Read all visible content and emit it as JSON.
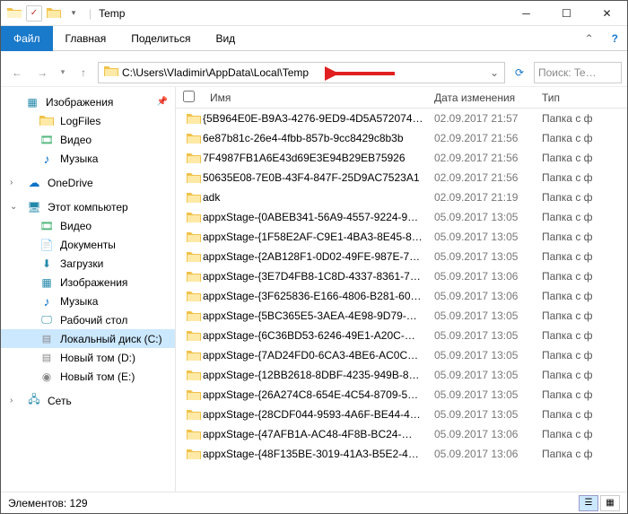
{
  "title": "Temp",
  "tabs": {
    "file": "Файл",
    "home": "Главная",
    "share": "Поделиться",
    "view": "Вид"
  },
  "address": "C:\\Users\\Vladimir\\AppData\\Local\\Temp",
  "search_placeholder": "Поиск: Te…",
  "sidebar": {
    "quick": {
      "label": "Изображения",
      "pin": "📌"
    },
    "quick_items": [
      {
        "icon": "folder",
        "label": "LogFiles"
      },
      {
        "icon": "video",
        "label": "Видео"
      },
      {
        "icon": "music",
        "label": "Музыка"
      }
    ],
    "onedrive": "OneDrive",
    "thispc": "Этот компьютер",
    "pc_items": [
      {
        "icon": "video",
        "label": "Видео"
      },
      {
        "icon": "doc",
        "label": "Документы"
      },
      {
        "icon": "dl",
        "label": "Загрузки"
      },
      {
        "icon": "pic",
        "label": "Изображения"
      },
      {
        "icon": "music",
        "label": "Музыка"
      },
      {
        "icon": "desk",
        "label": "Рабочий стол"
      },
      {
        "icon": "drive",
        "label": "Локальный диск (C:)",
        "selected": true
      },
      {
        "icon": "drive",
        "label": "Новый том (D:)"
      },
      {
        "icon": "cd",
        "label": "Новый том (E:)"
      }
    ],
    "network": "Сеть"
  },
  "columns": {
    "name": "Имя",
    "date": "Дата изменения",
    "type": "Тип"
  },
  "files": [
    {
      "name": "{5B964E0E-B9A3-4276-9ED9-4D5A572074…",
      "date": "02.09.2017 21:57",
      "type": "Папка с ф"
    },
    {
      "name": "6e87b81c-26e4-4fbb-857b-9cc8429c8b3b",
      "date": "02.09.2017 21:56",
      "type": "Папка с ф"
    },
    {
      "name": "7F4987FB1A6E43d69E3E94B29EB75926",
      "date": "02.09.2017 21:56",
      "type": "Папка с ф"
    },
    {
      "name": "50635E08-7E0B-43F4-847F-25D9AC7523A1",
      "date": "02.09.2017 21:56",
      "type": "Папка с ф"
    },
    {
      "name": "adk",
      "date": "02.09.2017 21:19",
      "type": "Папка с ф"
    },
    {
      "name": "appxStage-{0ABEB341-56A9-4557-9224-9…",
      "date": "05.09.2017 13:05",
      "type": "Папка с ф"
    },
    {
      "name": "appxStage-{1F58E2AF-C9E1-4BA3-8E45-8…",
      "date": "05.09.2017 13:05",
      "type": "Папка с ф"
    },
    {
      "name": "appxStage-{2AB128F1-0D02-49FE-987E-7…",
      "date": "05.09.2017 13:05",
      "type": "Папка с ф"
    },
    {
      "name": "appxStage-{3E7D4FB8-1C8D-4337-8361-7…",
      "date": "05.09.2017 13:06",
      "type": "Папка с ф"
    },
    {
      "name": "appxStage-{3F625836-E166-4806-B281-60…",
      "date": "05.09.2017 13:06",
      "type": "Папка с ф"
    },
    {
      "name": "appxStage-{5BC365E5-3AEA-4E98-9D79-…",
      "date": "05.09.2017 13:05",
      "type": "Папка с ф"
    },
    {
      "name": "appxStage-{6C36BD53-6246-49E1-A20C-…",
      "date": "05.09.2017 13:05",
      "type": "Папка с ф"
    },
    {
      "name": "appxStage-{7AD24FD0-6CA3-4BE6-AC0C…",
      "date": "05.09.2017 13:05",
      "type": "Папка с ф"
    },
    {
      "name": "appxStage-{12BB2618-8DBF-4235-949B-8…",
      "date": "05.09.2017 13:05",
      "type": "Папка с ф"
    },
    {
      "name": "appxStage-{26A274C8-654E-4C54-8709-5…",
      "date": "05.09.2017 13:05",
      "type": "Папка с ф"
    },
    {
      "name": "appxStage-{28CDF044-9593-4A6F-BE44-4…",
      "date": "05.09.2017 13:05",
      "type": "Папка с ф"
    },
    {
      "name": "appxStage-{47AFB1A-AC48-4F8B-BC24-…",
      "date": "05.09.2017 13:06",
      "type": "Папка с ф"
    },
    {
      "name": "appxStage-{48F135BE-3019-41A3-B5E2-4…",
      "date": "05.09.2017 13:06",
      "type": "Папка с ф"
    }
  ],
  "status": {
    "label": "Элементов:",
    "count": "129"
  }
}
